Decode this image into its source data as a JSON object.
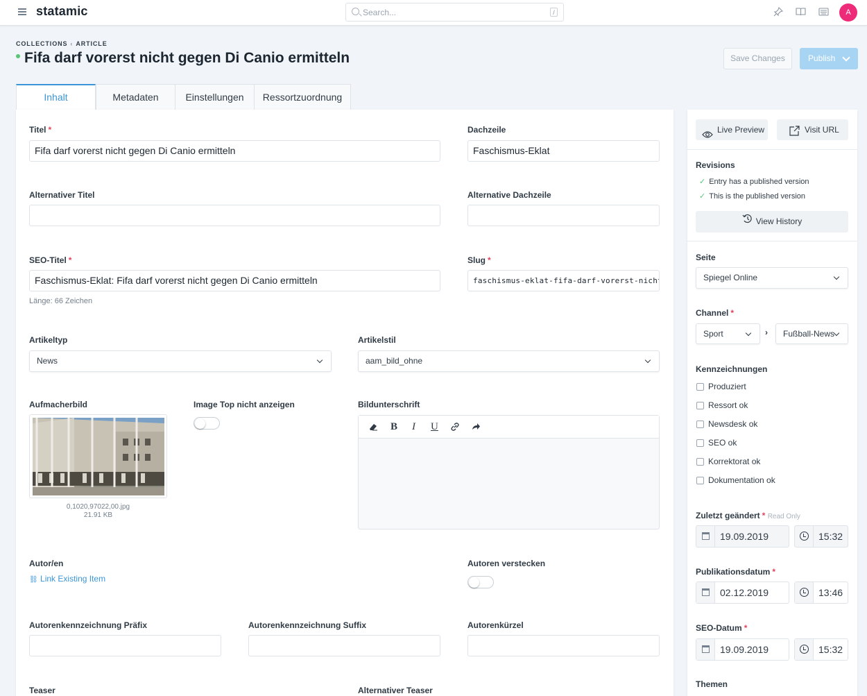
{
  "topbar": {
    "logo": "statamic",
    "search_placeholder": "Search...",
    "search_key": "/",
    "avatar_initial": "A",
    "icons": [
      "menu-icon",
      "search-icon",
      "pin-icon",
      "book-icon",
      "keyboard-icon"
    ]
  },
  "header": {
    "breadcrumb": [
      "COLLECTIONS",
      "ARTICLE"
    ],
    "breadcrumb_sep": "‹",
    "title": "Fifa darf vorerst nicht gegen Di Canio ermitteln",
    "save_label": "Save Changes",
    "publish_label": "Publish",
    "status_color": "#5ac479"
  },
  "tabs": [
    "Inhalt",
    "Metadaten",
    "Einstellungen",
    "Ressortzuordnung"
  ],
  "form": {
    "titel": {
      "label": "Titel",
      "value": "Fifa darf vorerst nicht gegen Di Canio ermitteln"
    },
    "dachzeile": {
      "label": "Dachzeile",
      "value": "Faschismus-Eklat"
    },
    "alt_titel": {
      "label": "Alternativer Titel",
      "value": ""
    },
    "alt_dachzeile": {
      "label": "Alternative Dachzeile",
      "value": ""
    },
    "seo_titel": {
      "label": "SEO-Titel",
      "value": "Faschismus-Eklat: Fifa darf vorerst nicht gegen Di Canio ermitteln",
      "help": "Länge: 66 Zeichen"
    },
    "slug": {
      "label": "Slug",
      "value": "faschismus-eklat-fifa-darf-vorerst-nicht-"
    },
    "artikeltyp": {
      "label": "Artikeltyp",
      "value": "News"
    },
    "artikelstil": {
      "label": "Artikelstil",
      "value": "aam_bild_ohne"
    },
    "aufmacherbild": {
      "label": "Aufmacherbild",
      "filename": "0,1020,97022,00.jpg",
      "size": "21.91 KB"
    },
    "image_top": {
      "label": "Image Top nicht anzeigen",
      "on": false
    },
    "bildunterschrift": {
      "label": "Bildunterschrift",
      "toolbar": [
        "B",
        "I",
        "U"
      ]
    },
    "autoren": {
      "label": "Autor/en",
      "link": "Link Existing Item"
    },
    "autoren_verstecken": {
      "label": "Autoren verstecken",
      "on": false
    },
    "praefix": {
      "label": "Autorenkennzeichnung Präfix"
    },
    "suffix": {
      "label": "Autorenkennzeichnung Suffix"
    },
    "kuerzel": {
      "label": "Autorenkürzel"
    },
    "teaser": {
      "label": "Teaser"
    },
    "alt_teaser": {
      "label": "Alternativer Teaser"
    }
  },
  "sidebar": {
    "live_preview": "Live Preview",
    "visit_url": "Visit URL",
    "revisions_title": "Revisions",
    "revisions": [
      "Entry has a published version",
      "This is the published version"
    ],
    "view_history": "View History",
    "seite": {
      "label": "Seite",
      "value": "Spiegel Online"
    },
    "channel": {
      "label": "Channel",
      "value1": "Sport",
      "value2": "Fußball-News",
      "sep": "›"
    },
    "kennzeichnungen": {
      "label": "Kennzeichnungen",
      "items": [
        "Produziert",
        "Ressort ok",
        "Newsdesk ok",
        "SEO ok",
        "Korrektorat ok",
        "Dokumentation ok"
      ]
    },
    "zuletzt": {
      "label": "Zuletzt geändert",
      "note": "Read Only",
      "date": "19.09.2019",
      "time": "15:32"
    },
    "publikation": {
      "label": "Publikationsdatum",
      "date": "02.12.2019",
      "time": "13:46"
    },
    "seo_datum": {
      "label": "SEO-Datum",
      "date": "19.09.2019",
      "time": "15:32"
    },
    "themen": {
      "label": "Themen"
    }
  }
}
